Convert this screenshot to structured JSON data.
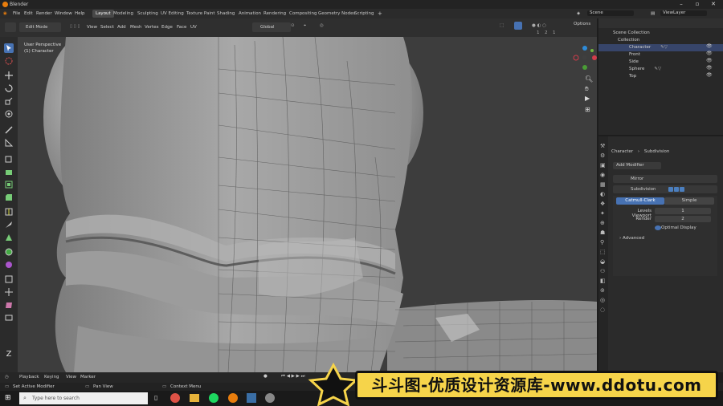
{
  "app": {
    "title": "Blender"
  },
  "menu": [
    "File",
    "Edit",
    "Render",
    "Window",
    "Help"
  ],
  "workspaces": [
    "Layout",
    "Modeling",
    "Sculpting",
    "UV Editing",
    "Texture Paint",
    "Shading",
    "Animation",
    "Rendering",
    "Compositing",
    "Geometry Nodes",
    "Scripting"
  ],
  "active_workspace": "Layout",
  "add_workspace": "+",
  "scene": {
    "name": "Scene",
    "view_layer": "ViewLayer"
  },
  "viewport_header": {
    "mode": "Edit Mode",
    "menus": [
      "View",
      "Select",
      "Add",
      "Mesh",
      "Vertex",
      "Edge",
      "Face",
      "UV"
    ],
    "orientation": "Global",
    "options": "Options",
    "counts": [
      "1",
      "2",
      "1"
    ]
  },
  "viewport_overlay": {
    "view_name": "User Perspective",
    "object": "(1) Character"
  },
  "outliner": {
    "rows": [
      {
        "label": "Scene Collection",
        "indent": 0
      },
      {
        "label": "Collection",
        "indent": 1
      },
      {
        "label": "Character",
        "indent": 2
      },
      {
        "label": "Front",
        "indent": 2
      },
      {
        "label": "Side",
        "indent": 2
      },
      {
        "label": "Sphere",
        "indent": 2
      },
      {
        "label": "Top",
        "indent": 2
      }
    ]
  },
  "properties": {
    "breadcrumb_object": "Character",
    "breadcrumb_modifier": "Subdivision",
    "add_modifier": "Add Modifier",
    "modifiers": [
      {
        "name": "Mirror",
        "expanded": false
      },
      {
        "name": "Subdivision",
        "expanded": true
      }
    ],
    "subdivision": {
      "tabs": [
        "Catmull-Clark",
        "Simple"
      ],
      "levels_viewport_label": "Levels Viewport",
      "levels_viewport": "1",
      "render_label": "Render",
      "render": "2",
      "optimal_display": "Optimal Display",
      "advanced": "Advanced"
    }
  },
  "timeline": {
    "menus": [
      "Playback",
      "Keying",
      "View",
      "Marker"
    ]
  },
  "statusbar": {
    "left": "Set Active Modifier",
    "middle": "Pan View",
    "right": "Context Menu"
  },
  "taskbar": {
    "search_placeholder": "Type here to search"
  },
  "watermark": {
    "text": "斗斗图-优质设计资源库-www.ddotu.com"
  },
  "colors": {
    "accent": "#4772b3",
    "active_tab": "#4772b3",
    "watermark_bg": "#f6d44a",
    "mesh": "#9a9a9a"
  }
}
